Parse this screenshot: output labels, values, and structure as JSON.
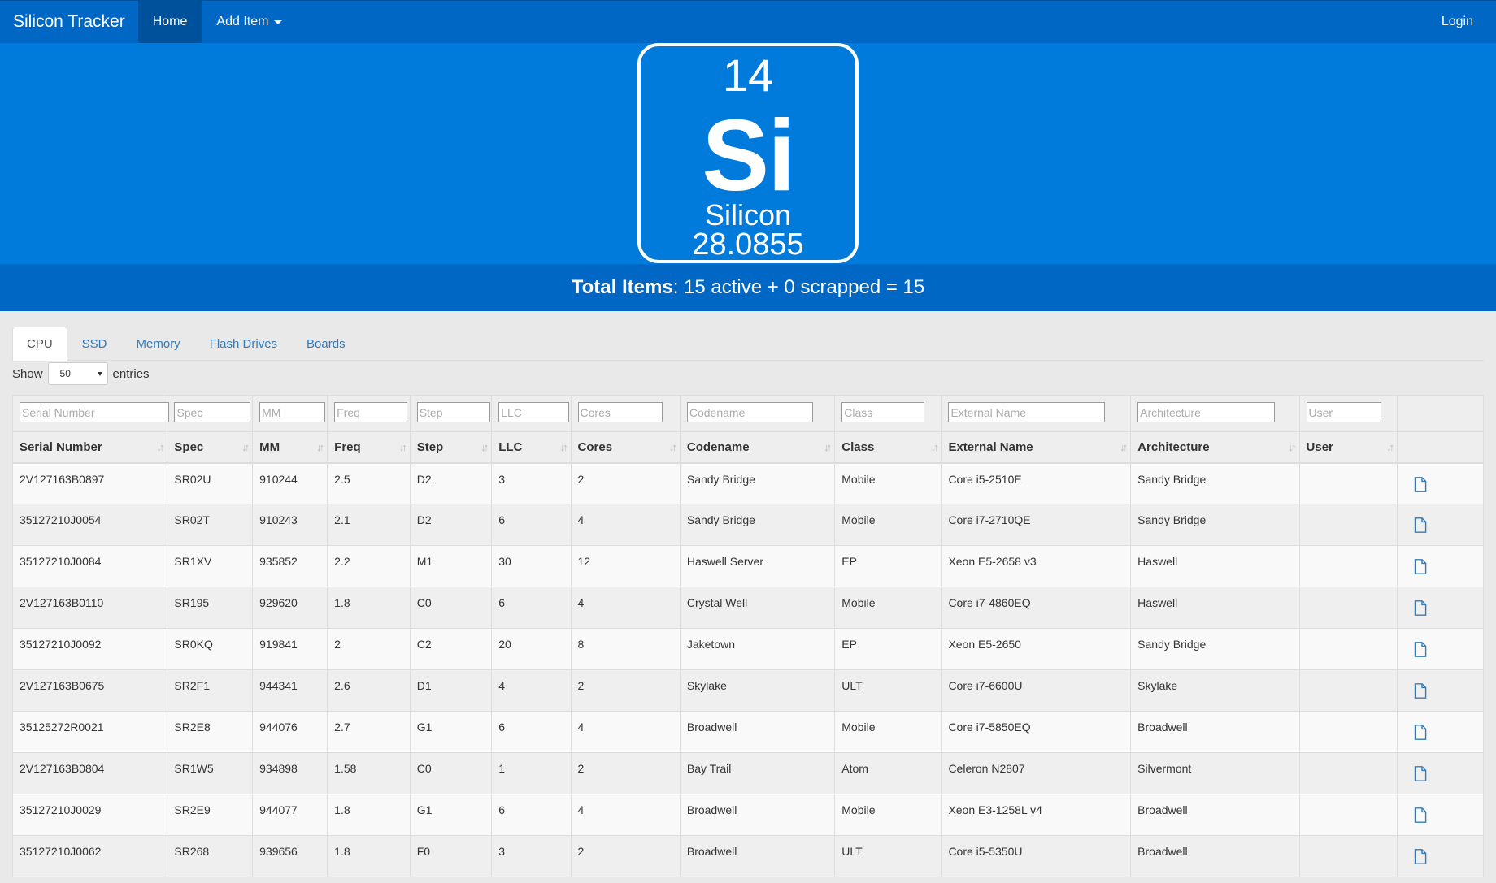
{
  "nav": {
    "brand": "Silicon Tracker",
    "home": "Home",
    "add_item": "Add Item",
    "login": "Login"
  },
  "element": {
    "number": "14",
    "symbol": "Si",
    "name": "Silicon",
    "mass": "28.0855"
  },
  "totals": {
    "label": "Total Items",
    "text": ": 15 active + 0 scrapped = 15"
  },
  "tabs": [
    "CPU",
    "SSD",
    "Memory",
    "Flash Drives",
    "Boards"
  ],
  "length": {
    "show": "Show",
    "value": "50",
    "entries": "entries"
  },
  "columns": [
    "Serial Number",
    "Spec",
    "MM",
    "Freq",
    "Step",
    "LLC",
    "Cores",
    "Codename",
    "Class",
    "External Name",
    "Architecture",
    "User"
  ],
  "filter_placeholders": [
    "Serial Number",
    "Spec",
    "MM",
    "Freq",
    "Step",
    "LLC",
    "Cores",
    "Codename",
    "Class",
    "External Name",
    "Architecture",
    "User"
  ],
  "rows": [
    [
      "2V127163B0897",
      "SR02U",
      "910244",
      "2.5",
      "D2",
      "3",
      "2",
      "Sandy Bridge",
      "Mobile",
      "Core i5-2510E",
      "Sandy Bridge",
      ""
    ],
    [
      "35127210J0054",
      "SR02T",
      "910243",
      "2.1",
      "D2",
      "6",
      "4",
      "Sandy Bridge",
      "Mobile",
      "Core i7-2710QE",
      "Sandy Bridge",
      ""
    ],
    [
      "35127210J0084",
      "SR1XV",
      "935852",
      "2.2",
      "M1",
      "30",
      "12",
      "Haswell Server",
      "EP",
      "Xeon E5-2658 v3",
      "Haswell",
      ""
    ],
    [
      "2V127163B0110",
      "SR195",
      "929620",
      "1.8",
      "C0",
      "6",
      "4",
      "Crystal Well",
      "Mobile",
      "Core i7-4860EQ",
      "Haswell",
      ""
    ],
    [
      "35127210J0092",
      "SR0KQ",
      "919841",
      "2",
      "C2",
      "20",
      "8",
      "Jaketown",
      "EP",
      "Xeon E5-2650",
      "Sandy Bridge",
      ""
    ],
    [
      "2V127163B0675",
      "SR2F1",
      "944341",
      "2.6",
      "D1",
      "4",
      "2",
      "Skylake",
      "ULT",
      "Core i7-6600U",
      "Skylake",
      ""
    ],
    [
      "35125272R0021",
      "SR2E8",
      "944076",
      "2.7",
      "G1",
      "6",
      "4",
      "Broadwell",
      "Mobile",
      "Core i7-5850EQ",
      "Broadwell",
      ""
    ],
    [
      "2V127163B0804",
      "SR1W5",
      "934898",
      "1.58",
      "C0",
      "1",
      "2",
      "Bay Trail",
      "Atom",
      "Celeron N2807",
      "Silvermont",
      ""
    ],
    [
      "35127210J0029",
      "SR2E9",
      "944077",
      "1.8",
      "G1",
      "6",
      "4",
      "Broadwell",
      "Mobile",
      "Xeon E3-1258L v4",
      "Broadwell",
      ""
    ],
    [
      "35127210J0062",
      "SR268",
      "939656",
      "1.8",
      "F0",
      "3",
      "2",
      "Broadwell",
      "ULT",
      "Core i5-5350U",
      "Broadwell",
      ""
    ]
  ],
  "colors": {
    "navbar": "#0067c5",
    "hero": "#007bdc",
    "link": "#337ab7"
  },
  "icons": {
    "row_action": "document-icon",
    "sort": "sort-both-icon",
    "dropdown": "caret-down-icon"
  }
}
